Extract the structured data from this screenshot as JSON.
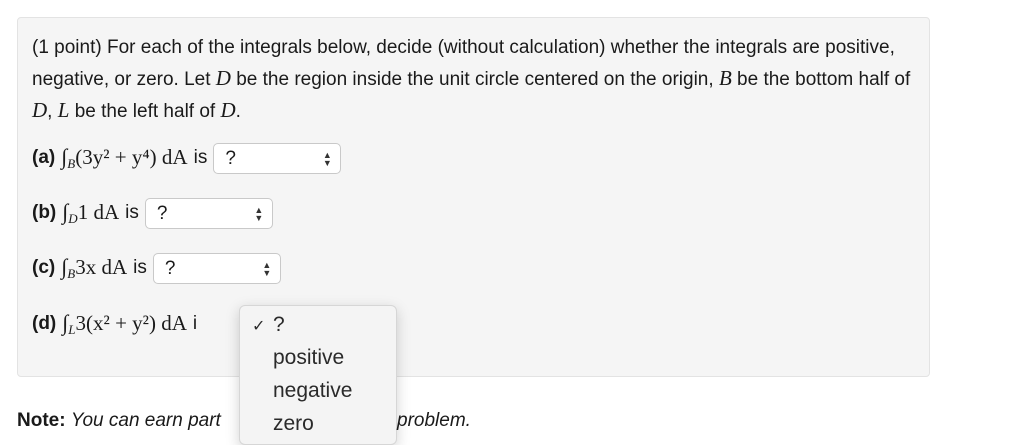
{
  "problem": {
    "intro_part1": "(1 point) For each of the integrals below, decide (without calculation) whether the integrals are positive, negative, or zero. Let ",
    "var_D": "D",
    "intro_part2": " be the region inside the unit circle centered on the origin, ",
    "var_B": "B",
    "intro_part3": " be the bottom half of ",
    "var_D2": "D",
    "intro_part4": ", ",
    "var_L": "L",
    "intro_part5": " be the left half of ",
    "var_D3": "D",
    "intro_part6": "."
  },
  "parts": [
    {
      "label": "(a)",
      "region": "B",
      "integrand": "(3y² + y⁴) dA",
      "is_text": "is",
      "selected": "?"
    },
    {
      "label": "(b)",
      "region": "D",
      "integrand": "1 dA",
      "is_text": "is",
      "selected": "?"
    },
    {
      "label": "(c)",
      "region": "B",
      "integrand": "3x dA",
      "is_text": "is",
      "selected": "?"
    },
    {
      "label": "(d)",
      "region": "L",
      "integrand": "3(x² + y²) dA",
      "is_text": "i",
      "selected": "?"
    }
  ],
  "integral_symbol": "∫",
  "dropdown": {
    "check": "✓",
    "options": [
      "?",
      "positive",
      "negative",
      "zero"
    ]
  },
  "note": {
    "bold": "Note:",
    "text_visible": "You can earn part",
    "text_end": "problem."
  },
  "icons": {
    "select_arrows": "updown-arrows-icon",
    "check": "checkmark-icon"
  }
}
